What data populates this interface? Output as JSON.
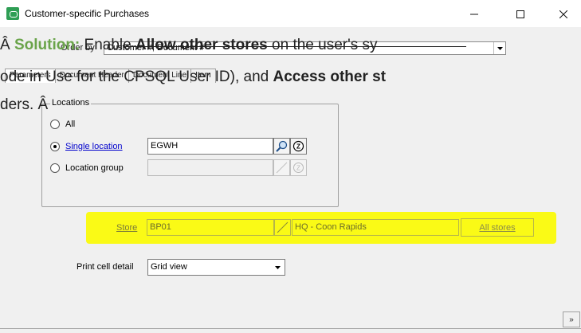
{
  "window": {
    "title": "Customer-specific Purchases",
    "minimize": "–",
    "maximize": "☐",
    "close": "✕"
  },
  "order_by": {
    "label": "Order by",
    "value": "Customer #, Document #"
  },
  "tabs": [
    {
      "label": "Parameters",
      "active": true
    },
    {
      "label": "Document Header"
    },
    {
      "label": "Document Line"
    },
    {
      "label": "Item"
    }
  ],
  "overlay_text": {
    "line1_prefix": "Â ",
    "line1_solution": "Solution:",
    "line1_mid": " Enable ",
    "line1_bold": "Allow other stores",
    "line1_suffix": " on the user's sy",
    "line2_prefix": "ode in Use for the CPSQL User ID), and ",
    "line2_bold": "Access other st",
    "line3": "ders. Â"
  },
  "locations": {
    "legend": "Locations",
    "options": [
      {
        "label": "All",
        "checked": false
      },
      {
        "label": "Single location",
        "checked": true,
        "value": "EGWH"
      },
      {
        "label": "Location group",
        "checked": false,
        "value": ""
      }
    ]
  },
  "store": {
    "label": "Store",
    "value": "BP01",
    "name": "HQ - Coon Rapids",
    "all_stores_label": "All stores",
    "highlight_color": "#fafa0a"
  },
  "print_cell_detail": {
    "label": "Print cell detail",
    "value": "Grid view"
  },
  "more_button": "»",
  "colors": {
    "app_icon": "#2e9e54",
    "solution_text": "#6aa44a",
    "link": "#0000cc",
    "window_bg": "#f0f0f0"
  }
}
